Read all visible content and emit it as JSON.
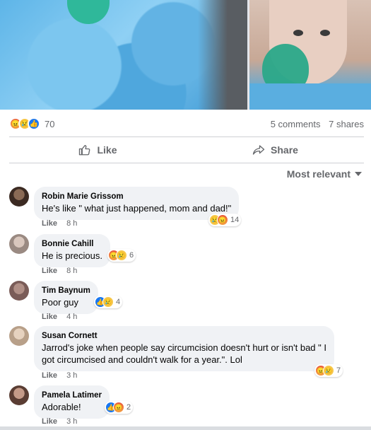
{
  "post_stats": {
    "reaction_count": "70",
    "comments": "5 comments",
    "shares": "7 shares"
  },
  "actions": {
    "like_label": "Like",
    "share_label": "Share"
  },
  "sort": {
    "label": "Most relevant"
  },
  "comments": [
    {
      "author": "Robin Marie Grissom",
      "text": "He's like \" what just happened, mom and dad!\"",
      "like": "Like",
      "time": "8 h",
      "reaction_count": "14"
    },
    {
      "author": "Bonnie Cahill",
      "text": "He is precious.",
      "like": "Like",
      "time": "8 h",
      "reaction_count": "6"
    },
    {
      "author": "Tim Baynum",
      "text": "Poor guy",
      "like": "Like",
      "time": "4 h",
      "reaction_count": "4"
    },
    {
      "author": "Susan Cornett",
      "text_line1": "Jarrod's joke when people say circumcision doesn't hurt or isn't bad \" I",
      "text_line2": "got circumcised and couldn't walk for a year.\". Lol",
      "like": "Like",
      "time": "3 h",
      "reaction_count": "7"
    },
    {
      "author": "Pamela Latimer",
      "text": "Adorable!",
      "like": "Like",
      "time": "3 h",
      "reaction_count": "2"
    }
  ],
  "colors": {
    "like_blue": "#1877f2",
    "muted_text": "#65676b",
    "bubble_bg": "#f0f2f5"
  }
}
